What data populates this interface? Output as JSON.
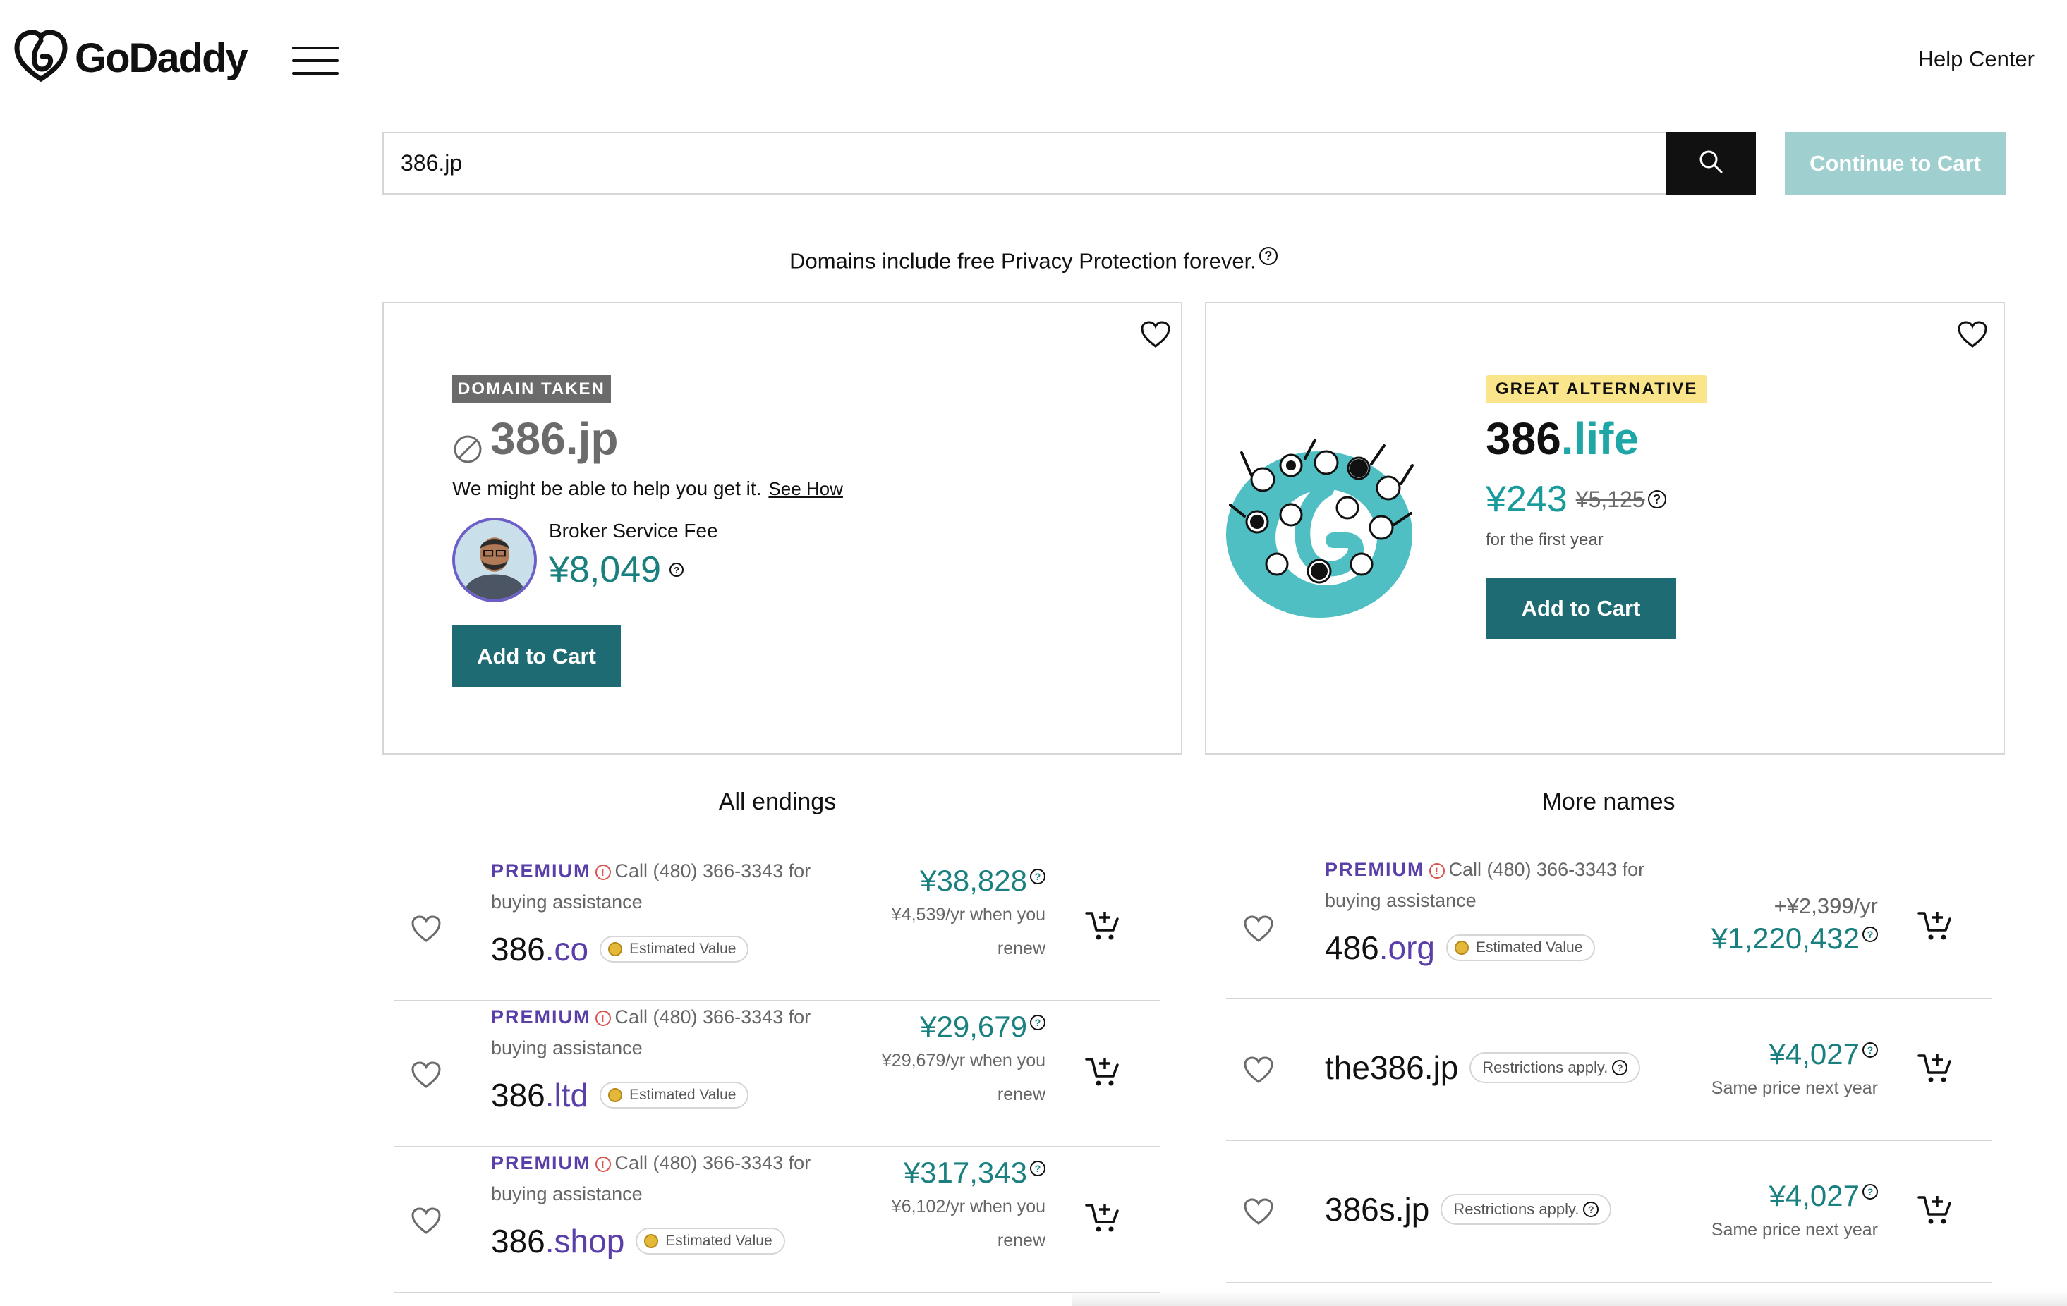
{
  "header": {
    "brand": "GoDaddy",
    "help_center": "Help Center",
    "icons": [
      "godaddy-logo-icon",
      "hamburger-menu-icon"
    ]
  },
  "search": {
    "value": "386.jp",
    "placeholder": "",
    "search_icon": "search-icon",
    "continue_label": "Continue to Cart"
  },
  "privacy_note": "Domains include free Privacy Protection forever.",
  "taken_card": {
    "badge": "DOMAIN TAKEN",
    "domain": "386.jp",
    "help_text": "We might be able to help you get it.",
    "see_how": "See How",
    "broker_label": "Broker Service Fee",
    "broker_price": "¥8,049",
    "add_to_cart": "Add to Cart"
  },
  "alt_card": {
    "badge": "GREAT ALTERNATIVE",
    "sld": "386",
    "tld": ".life",
    "price": "¥243",
    "old_price": "¥5,125",
    "term": "for the first year",
    "add_to_cart": "Add to Cart"
  },
  "sections": {
    "left_title": "All endings",
    "right_title": "More names"
  },
  "all_endings": [
    {
      "premium": "PREMIUM",
      "assist": "Call (480) 366-3343 for buying assistance",
      "sld": "386",
      "tld": ".co",
      "badge": "Estimated Value",
      "price": "¥38,828",
      "renew": "¥4,539/yr when you renew"
    },
    {
      "premium": "PREMIUM",
      "assist": "Call (480) 366-3343 for buying assistance",
      "sld": "386",
      "tld": ".ltd",
      "badge": "Estimated Value",
      "price": "¥29,679",
      "renew": "¥29,679/yr when you renew"
    },
    {
      "premium": "PREMIUM",
      "assist": "Call (480) 366-3343 for buying assistance",
      "sld": "386",
      "tld": ".shop",
      "badge": "Estimated Value",
      "price": "¥317,343",
      "renew": "¥6,102/yr when you renew"
    }
  ],
  "more_names": [
    {
      "premium": "PREMIUM",
      "assist": "Call (480) 366-3343 for buying assistance",
      "sld": "486",
      "tld": ".org",
      "badge": "Estimated Value",
      "per_year": "+¥2,399/yr",
      "price": "¥1,220,432"
    },
    {
      "domain": "the386.jp",
      "badge": "Restrictions apply.",
      "price": "¥4,027",
      "note": "Same price next year"
    },
    {
      "domain": "386s.jp",
      "badge": "Restrictions apply.",
      "price": "¥4,027",
      "note": "Same price next year"
    }
  ],
  "colors": {
    "teal_button": "#1f6b73",
    "teal_price": "#1a7f7f",
    "premium_purple": "#5a3fa8",
    "taken_badge": "#6b6b6b",
    "alt_badge": "#fbe58a",
    "continue_disabled": "#9fcfcf"
  }
}
